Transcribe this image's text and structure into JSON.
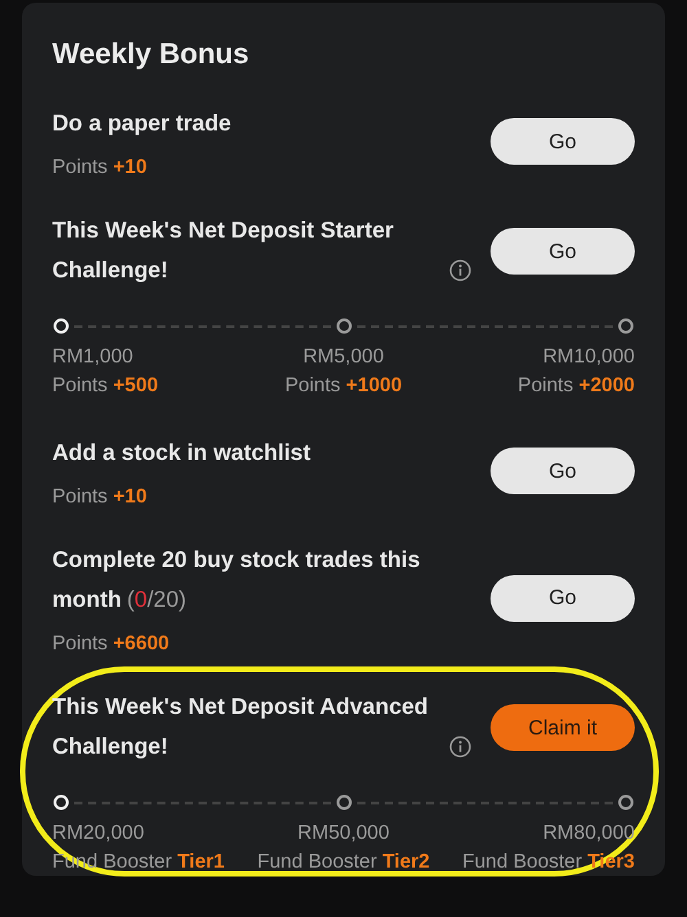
{
  "title": "Weekly Bonus",
  "tasks": [
    {
      "kind": "task",
      "title": "Do a paper trade",
      "info": false,
      "points_label": "Points",
      "points": "+10",
      "button": {
        "label": "Go",
        "kind": "secondary"
      }
    },
    {
      "kind": "challenge",
      "title": "This Week's Net Deposit Starter Challenge!",
      "info": true,
      "button": {
        "label": "Go",
        "kind": "secondary"
      },
      "milestones": [
        {
          "amount": "RM1,000",
          "reward_label": "Points",
          "reward": "+500",
          "reached": true
        },
        {
          "amount": "RM5,000",
          "reward_label": "Points",
          "reward": "+1000",
          "reached": false
        },
        {
          "amount": "RM10,000",
          "reward_label": "Points",
          "reward": "+2000",
          "reached": false
        }
      ]
    },
    {
      "kind": "task",
      "title": "Add a stock in watchlist",
      "info": false,
      "points_label": "Points",
      "points": "+10",
      "button": {
        "label": "Go",
        "kind": "secondary"
      }
    },
    {
      "kind": "task",
      "title": "Complete 20 buy stock trades this month",
      "info": false,
      "progress": [
        {
          "text": "(",
          "highlight": false
        },
        {
          "text": "0",
          "highlight": true
        },
        {
          "text": "/20)",
          "highlight": false
        }
      ],
      "points_label": "Points",
      "points": "+6600",
      "button": {
        "label": "Go",
        "kind": "secondary"
      }
    },
    {
      "kind": "challenge",
      "title": "This Week's Net Deposit Advanced Challenge!",
      "info": true,
      "button": {
        "label": "Claim it",
        "kind": "primary"
      },
      "milestones": [
        {
          "amount": "RM20,000",
          "reward_label": "Fund Booster",
          "reward": "Tier1",
          "reached": true
        },
        {
          "amount": "RM50,000",
          "reward_label": "Fund Booster",
          "reward": "Tier2",
          "reached": false
        },
        {
          "amount": "RM80,000",
          "reward_label": "Fund Booster",
          "reward": "Tier3",
          "reached": false
        }
      ]
    }
  ]
}
